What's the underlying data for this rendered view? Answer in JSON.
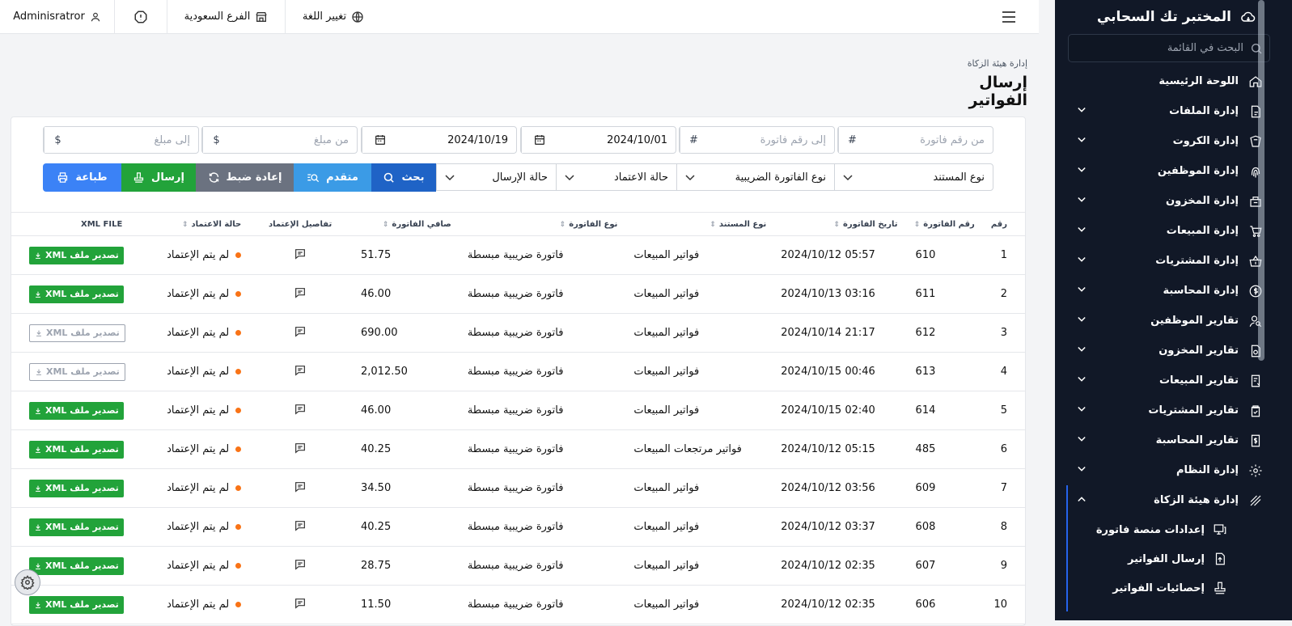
{
  "brand": {
    "name": "المختبر تك السحابي"
  },
  "sidebar": {
    "search_placeholder": "البحث في القائمة",
    "items": [
      {
        "label": "اللوحة الرئيسية",
        "icon": "home-icon",
        "chevron": false
      },
      {
        "label": "إدارة الملفات",
        "icon": "files-icon",
        "chevron": true
      },
      {
        "label": "إدارة الكروت",
        "icon": "cards-icon",
        "chevron": true
      },
      {
        "label": "إدارة الموظفين",
        "icon": "fingerprint-icon",
        "chevron": true
      },
      {
        "label": "إدارة المخزون",
        "icon": "inventory-icon",
        "chevron": true
      },
      {
        "label": "إدارة المبيعات",
        "icon": "cart-icon",
        "chevron": true
      },
      {
        "label": "إدارة المشتريات",
        "icon": "basket-icon",
        "chevron": true
      },
      {
        "label": "إدارة المحاسبة",
        "icon": "money-icon",
        "chevron": true
      },
      {
        "label": "تقارير الموظفين",
        "icon": "user-search-icon",
        "chevron": true
      },
      {
        "label": "تقارير المخزون",
        "icon": "report-icon",
        "chevron": true
      },
      {
        "label": "تقارير المبيعات",
        "icon": "sales-report-icon",
        "chevron": true
      },
      {
        "label": "تقارير المشتريات",
        "icon": "clipboard-icon",
        "chevron": true
      },
      {
        "label": "تقارير المحاسبة",
        "icon": "invoice-icon",
        "chevron": true
      },
      {
        "label": "إدارة النظام",
        "icon": "gear-icon",
        "chevron": true
      },
      {
        "label": "إدارة هيئة الزكاة",
        "icon": "stripes-icon",
        "chevron": true,
        "expanded": true
      }
    ],
    "subitems": [
      {
        "label": "إعدادات منصة فاتورة",
        "icon": "monitor-icon"
      },
      {
        "label": "إرسال الفواتير",
        "icon": "upload-icon"
      },
      {
        "label": "إحصائيات الفواتير",
        "icon": "stamp-icon"
      }
    ]
  },
  "topbar": {
    "user": "Adminisratror",
    "branch": "الفرع السعودية",
    "language": "تغيير اللغة"
  },
  "page": {
    "breadcrumb": "إدارة هيئة الزكاة",
    "title": "إرسال الفواتير"
  },
  "filters": {
    "from_invoice_placeholder": "من رقم فاتورة",
    "to_invoice_placeholder": "إلى رقم فاتورة",
    "hash": "#",
    "date_from": "2024/10/01",
    "date_to": "2024/10/19",
    "from_amount_placeholder": "من مبلغ",
    "to_amount_placeholder": "إلى مبلغ",
    "currency": "$",
    "doc_type": "نوع المستند",
    "tax_invoice_type": "نوع الفاتورة الضريبية",
    "approval_status": "حالة الاعتماد",
    "send_status": "حالة الإرسال"
  },
  "buttons": {
    "search": "بحث",
    "advanced": "متقدم",
    "reset": "إعادة ضبط",
    "send": "إرسال",
    "print": "طباعة"
  },
  "table": {
    "headers": [
      "رقم",
      "رقم الفاتورة",
      "تاريخ الفاتورة",
      "نوع المستند",
      "نوع الفاتورة",
      "صافي الفاتورة",
      "تفاصيل الإعتماد",
      "حالة الاعتماد",
      "XML FILE"
    ],
    "export_label": "تصدير ملف XML",
    "rows": [
      {
        "n": "1",
        "inv": "610",
        "date": "2024/10/12 05:57",
        "doc": "فواتير المبيعات",
        "type": "فاتورة ضريبية مبسطة",
        "net": "51.75",
        "status": "لم يتم الإعتماد",
        "export_enabled": true
      },
      {
        "n": "2",
        "inv": "611",
        "date": "2024/10/13 03:16",
        "doc": "فواتير المبيعات",
        "type": "فاتورة ضريبية مبسطة",
        "net": "46.00",
        "status": "لم يتم الإعتماد",
        "export_enabled": true
      },
      {
        "n": "3",
        "inv": "612",
        "date": "2024/10/14 21:17",
        "doc": "فواتير المبيعات",
        "type": "فاتورة ضريبية مبسطة",
        "net": "690.00",
        "status": "لم يتم الإعتماد",
        "export_enabled": false
      },
      {
        "n": "4",
        "inv": "613",
        "date": "2024/10/15 00:46",
        "doc": "فواتير المبيعات",
        "type": "فاتورة ضريبية مبسطة",
        "net": "2,012.50",
        "status": "لم يتم الإعتماد",
        "export_enabled": false
      },
      {
        "n": "5",
        "inv": "614",
        "date": "2024/10/15 02:40",
        "doc": "فواتير المبيعات",
        "type": "فاتورة ضريبية مبسطة",
        "net": "46.00",
        "status": "لم يتم الإعتماد",
        "export_enabled": true
      },
      {
        "n": "6",
        "inv": "485",
        "date": "2024/10/12 05:15",
        "doc": "فواتير مرتجعات المبيعات",
        "type": "فاتورة ضريبية مبسطة",
        "net": "40.25",
        "status": "لم يتم الإعتماد",
        "export_enabled": true
      },
      {
        "n": "7",
        "inv": "609",
        "date": "2024/10/12 03:56",
        "doc": "فواتير المبيعات",
        "type": "فاتورة ضريبية مبسطة",
        "net": "34.50",
        "status": "لم يتم الإعتماد",
        "export_enabled": true
      },
      {
        "n": "8",
        "inv": "608",
        "date": "2024/10/12 03:37",
        "doc": "فواتير المبيعات",
        "type": "فاتورة ضريبية مبسطة",
        "net": "40.25",
        "status": "لم يتم الإعتماد",
        "export_enabled": true
      },
      {
        "n": "9",
        "inv": "607",
        "date": "2024/10/12 02:35",
        "doc": "فواتير المبيعات",
        "type": "فاتورة ضريبية مبسطة",
        "net": "28.75",
        "status": "لم يتم الإعتماد",
        "export_enabled": true
      },
      {
        "n": "10",
        "inv": "606",
        "date": "2024/10/12 02:35",
        "doc": "فواتير المبيعات",
        "type": "فاتورة ضريبية مبسطة",
        "net": "11.50",
        "status": "لم يتم الإعتماد",
        "export_enabled": true
      }
    ]
  },
  "colors": {
    "primary": "#1f63c6",
    "info": "#3b9be6",
    "secondary": "#6b7280",
    "success": "#22a33a",
    "print": "#3b82f6",
    "status_dot": "#f97316",
    "sidebar_bg": "#111827"
  }
}
